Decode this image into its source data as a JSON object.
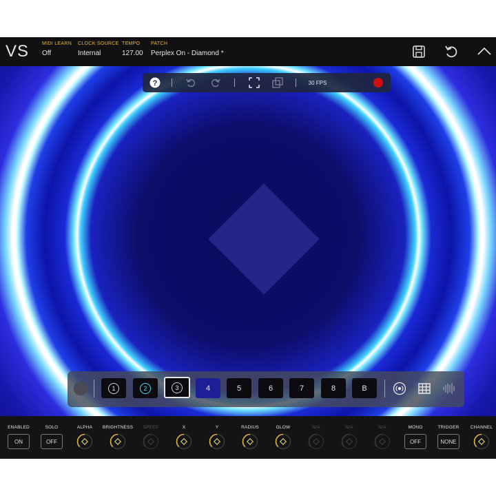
{
  "app": {
    "logo": "VS"
  },
  "header": {
    "midi_learn": {
      "label": "MIDI LEARN",
      "value": "Off"
    },
    "clock_source": {
      "label": "CLOCK SOURCE",
      "value": "Internal"
    },
    "tempo": {
      "label": "TEMPO",
      "value": "127.00"
    },
    "patch": {
      "label": "PATCH",
      "value": "Perplex On - Diamond *"
    }
  },
  "toolbar": {
    "fps": "30 FPS",
    "record_color": "#d01010"
  },
  "slots": [
    {
      "label": "1",
      "style": "circle"
    },
    {
      "label": "2",
      "style": "circle-cyan"
    },
    {
      "label": "3",
      "style": "circle-active"
    },
    {
      "label": "4",
      "style": "blue"
    },
    {
      "label": "5",
      "style": "plain"
    },
    {
      "label": "6",
      "style": "plain"
    },
    {
      "label": "7",
      "style": "plain"
    },
    {
      "label": "8",
      "style": "plain"
    },
    {
      "label": "B",
      "style": "plain"
    }
  ],
  "params": [
    {
      "label": "ENABLED",
      "kind": "button",
      "value": "ON"
    },
    {
      "label": "SOLO",
      "kind": "button",
      "value": "OFF"
    },
    {
      "label": "ALPHA",
      "kind": "knob"
    },
    {
      "label": "BRIGHTNESS",
      "kind": "knob"
    },
    {
      "label": "SPEED",
      "kind": "knob-dim"
    },
    {
      "label": "X",
      "kind": "knob"
    },
    {
      "label": "Y",
      "kind": "knob"
    },
    {
      "label": "RADIUS",
      "kind": "knob"
    },
    {
      "label": "GLOW",
      "kind": "knob"
    },
    {
      "label": "N/A",
      "kind": "knob-dim"
    },
    {
      "label": "N/A",
      "kind": "knob-dim"
    },
    {
      "label": "N/A",
      "kind": "knob-dim"
    },
    {
      "label": "MONO",
      "kind": "button",
      "value": "OFF"
    },
    {
      "label": "TRIGGER",
      "kind": "button",
      "value": "NONE"
    },
    {
      "label": "CHANNEL",
      "kind": "knob"
    }
  ],
  "colors": {
    "accent_label": "#e7b53c",
    "knob_ring": "#e7b53c",
    "visual_ring": "#3fd0ff",
    "visual_bg": "#0d0d6a"
  }
}
